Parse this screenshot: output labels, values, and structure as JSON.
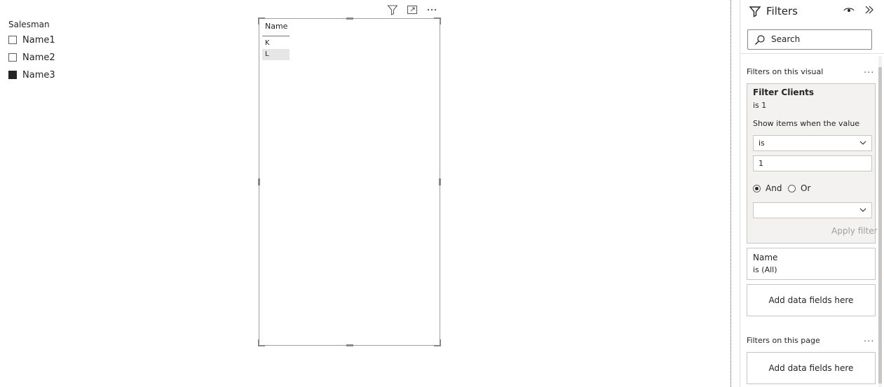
{
  "slicer": {
    "title": "Salesman",
    "items": [
      {
        "label": "Name1",
        "checked": false
      },
      {
        "label": "Name2",
        "checked": false
      },
      {
        "label": "Name3",
        "checked": true
      }
    ]
  },
  "table_visual": {
    "column_header": "Name",
    "rows": [
      "K",
      "L"
    ],
    "icons": [
      "filter-icon",
      "focus-mode-icon",
      "more-options-icon"
    ]
  },
  "filters_pane": {
    "title": "Filters",
    "search_placeholder": "Search",
    "visual_section": {
      "title": "Filters on this visual",
      "more": "...",
      "active_card": {
        "title": "Filter Clients",
        "summary": "is 1",
        "instruction": "Show items when the value",
        "operator": "is",
        "value": "1",
        "logic_and": "And",
        "logic_or": "Or",
        "second_operator": "",
        "apply_label": "Apply filter"
      },
      "name_card": {
        "title": "Name",
        "summary": "is (All)"
      },
      "add_fields": "Add data fields here"
    },
    "page_section": {
      "title": "Filters on this page",
      "more": "...",
      "add_fields": "Add data fields here"
    }
  },
  "colors": {
    "accent": "#118dff",
    "text": "#252423",
    "muted": "#a19f9d",
    "card_bg": "#f3f2f1"
  }
}
